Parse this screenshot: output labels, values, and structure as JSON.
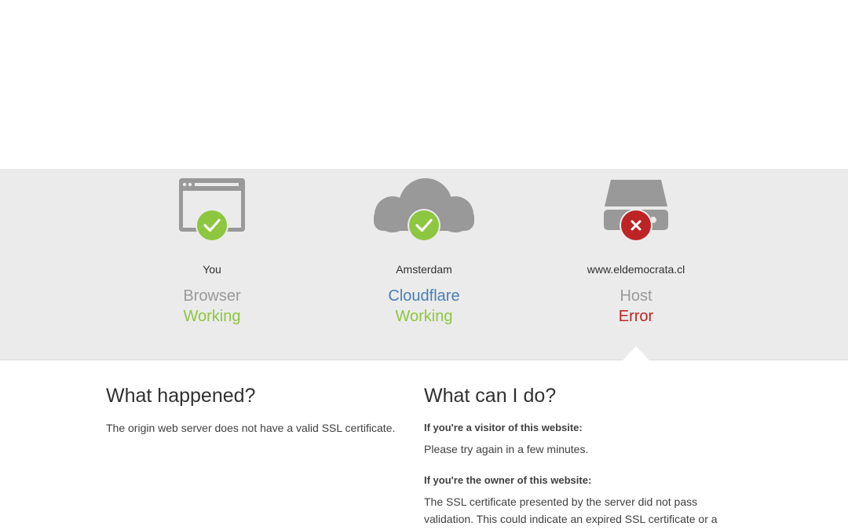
{
  "columns": [
    {
      "location": "You",
      "component": "Browser",
      "status": "Working",
      "icon": "browser-window-icon",
      "badge": "checkmark-icon"
    },
    {
      "location": "Amsterdam",
      "component": "Cloudflare",
      "status": "Working",
      "icon": "cloud-icon",
      "badge": "checkmark-icon"
    },
    {
      "location": "www.eldemocrata.cl",
      "component": "Host",
      "status": "Error",
      "icon": "server-icon",
      "badge": "x-icon"
    }
  ],
  "colors": {
    "ok": "#8dc63f",
    "error": "#bd2426",
    "link": "#4a7eb5",
    "icon_gray": "#999999",
    "band": "#ebebeb"
  },
  "what_happened": {
    "title": "What happened?",
    "body": "The origin web server does not have a valid SSL certificate."
  },
  "what_can_i_do": {
    "title": "What can I do?",
    "visitor_heading": "If you're a visitor of this website:",
    "visitor_body": "Please try again in a few minutes.",
    "owner_heading": "If you're the owner of this website:",
    "owner_body": "The SSL certificate presented by the server did not pass validation. This could indicate an expired SSL certificate or a certificate that"
  }
}
